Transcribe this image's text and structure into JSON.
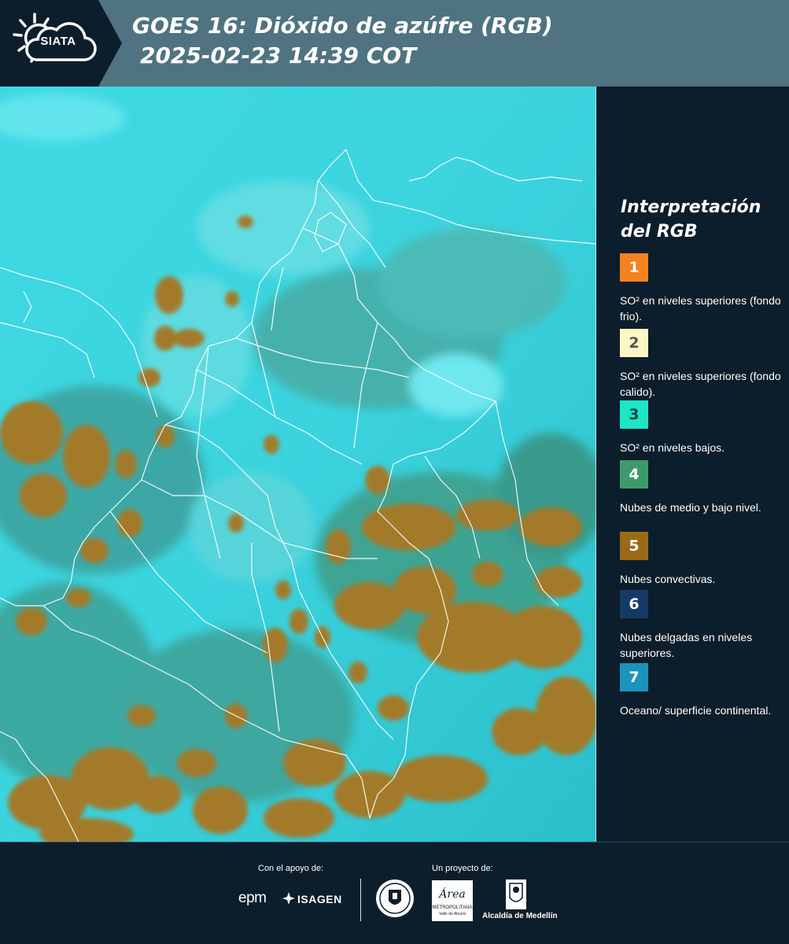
{
  "header": {
    "logo_text": "SIATA",
    "title_line1": "GOES 16: Dióxido de azúfre (RGB)",
    "title_line2": "2025-02-23 14:39 COT"
  },
  "legend": {
    "title_line1": "Interpretación",
    "title_line2": "del RGB",
    "items": [
      {
        "number": "1",
        "color": "#f5821f",
        "text_color": "#ffffff",
        "description": "SO² en niveles superiores (fondo frio)."
      },
      {
        "number": "2",
        "color": "#fdf6c3",
        "text_color": "#555555",
        "description": "SO² en niveles superiores (fondo calido)."
      },
      {
        "number": "3",
        "color": "#1fe5c7",
        "text_color": "#0c4a44",
        "description": "SO² en niveles bajos."
      },
      {
        "number": "4",
        "color": "#3e9a6b",
        "text_color": "#ffffff",
        "description": "Nubes de medio y bajo nivel."
      },
      {
        "number": "5",
        "color": "#9a6a18",
        "text_color": "#ffffff",
        "description": "Nubes convectivas."
      },
      {
        "number": "6",
        "color": "#153a66",
        "text_color": "#ffffff",
        "description": "Nubes delgadas en niveles superiores."
      },
      {
        "number": "7",
        "color": "#1b93bd",
        "text_color": "#ffffff",
        "description": "Oceano/ superficie continental."
      }
    ]
  },
  "footer": {
    "support_label": "Con el apoyo de:",
    "project_label": "Un proyecto de:",
    "epm": "epm",
    "isagen": "ISAGEN",
    "area_name": "Área",
    "area_sub1": "METROPOLITANA",
    "area_sub2": "Valle de Aburrá",
    "alcaldia": "Alcaldía de Medellín"
  },
  "colors": {
    "background": "#0c1e2b",
    "header_bar": "#4f7380",
    "map_cyan": "#35d4e0",
    "map_green": "#4aa9a0",
    "map_brown": "#a27a2c",
    "border_lines": "#ffffff"
  }
}
